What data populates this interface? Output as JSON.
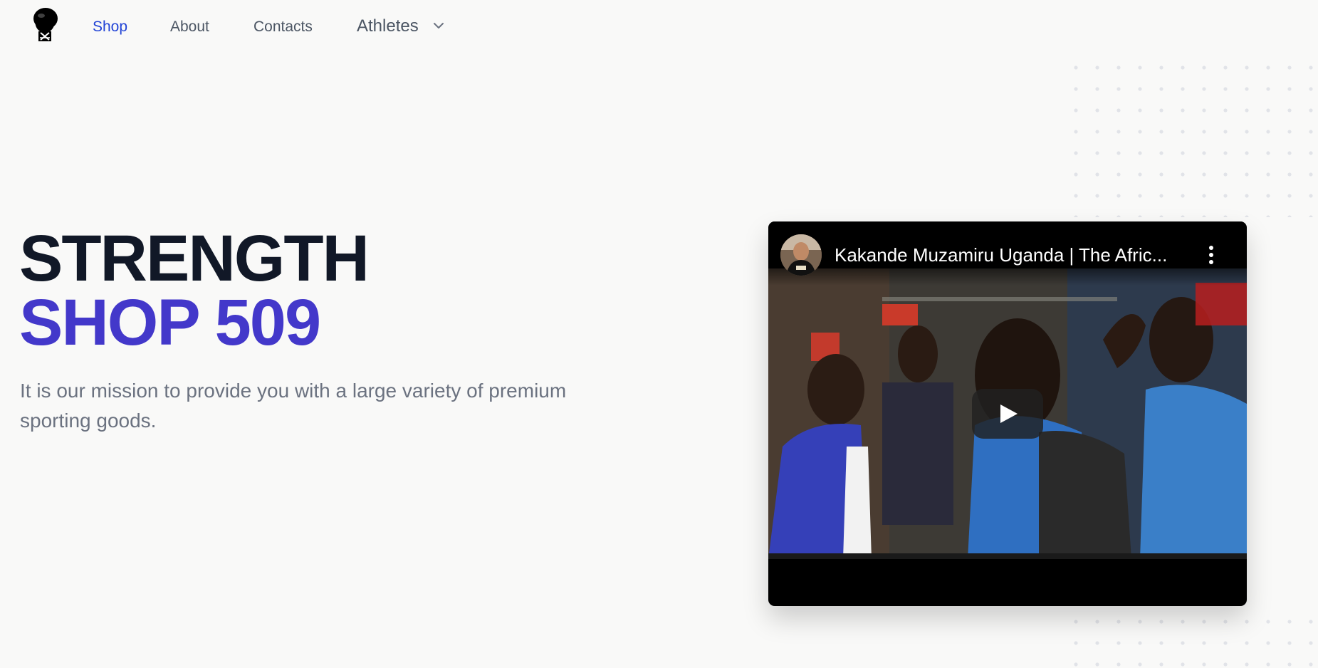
{
  "nav": {
    "logo": "boxing-glove-logo",
    "items": [
      {
        "label": "Shop",
        "active": true
      },
      {
        "label": "About",
        "active": false
      },
      {
        "label": "Contacts",
        "active": false
      },
      {
        "label": "Athletes",
        "active": false,
        "icon": "chevron-down-icon"
      }
    ]
  },
  "hero": {
    "title_line1": "STRENGTH",
    "title_line2": "SHOP 509",
    "subtitle": "It is our mission to provide you with a large variety of premium sporting goods."
  },
  "video": {
    "title": "Kakande Muzamiru Uganda | The Afric...",
    "avatar_icon": "channel-avatar",
    "menu_icon": "more-vertical-icon",
    "play_icon": "play-icon"
  },
  "colors": {
    "active_link": "#2244d6",
    "title_dark": "#111827",
    "title_accent": "#4338ca",
    "text_muted": "#6b7280",
    "background": "#f9f9f8"
  }
}
